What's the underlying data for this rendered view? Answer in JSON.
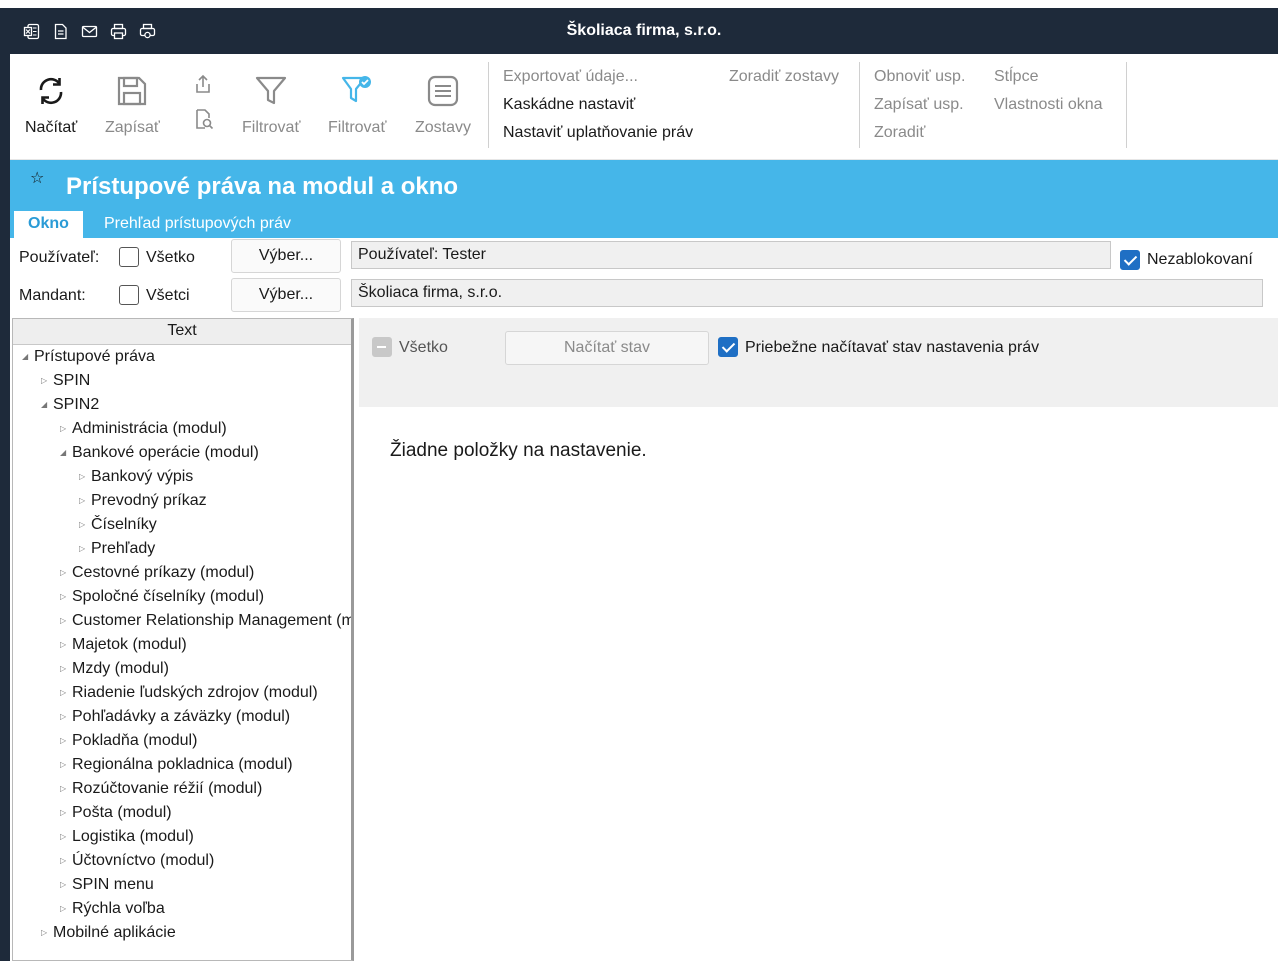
{
  "window": {
    "title": "Školiaca firma, s.r.o.",
    "title_icons": [
      "excel-icon",
      "document-icon",
      "mail-icon",
      "print-icon",
      "print-preview-icon"
    ]
  },
  "ribbon": {
    "buttons": [
      {
        "label": "Načítať",
        "icon": "refresh-icon",
        "enabled": true
      },
      {
        "label": "Zapísať",
        "icon": "save-icon",
        "enabled": false
      },
      {
        "label": "Filtrovať",
        "icon": "filter-icon",
        "enabled": false
      },
      {
        "label": "Filtrovať",
        "icon": "filter-active-icon",
        "enabled": false
      },
      {
        "label": "Zostavy",
        "icon": "reports-icon",
        "enabled": false
      }
    ],
    "small_icons": [
      "share-icon",
      "find-document-icon"
    ],
    "links_group1": [
      {
        "label": "Exportovať údaje...",
        "enabled": false
      },
      {
        "label": "Kaskádne nastaviť",
        "enabled": true
      },
      {
        "label": "Nastaviť uplatňovanie práv",
        "enabled": true
      },
      {
        "label": "Zoradiť zostavy",
        "enabled": false
      }
    ],
    "links_group2": [
      {
        "label": "Obnoviť usp.",
        "enabled": false
      },
      {
        "label": "Zapísať usp.",
        "enabled": false
      },
      {
        "label": "Zoradiť",
        "enabled": false
      },
      {
        "label": "Stĺpce",
        "enabled": false
      },
      {
        "label": "Vlastnosti okna",
        "enabled": false
      }
    ]
  },
  "header": {
    "title": "Prístupové práva na modul a okno",
    "tabs": [
      "Okno",
      "Prehľad prístupových práv"
    ]
  },
  "filters": {
    "user_label": "Používateľ:",
    "user_all_label": "Všetko",
    "user_all_checked": false,
    "user_select_button": "Výber...",
    "user_value": "Používateľ: Tester",
    "not_blocked_label": "Nezablokovaní",
    "not_blocked_checked": true,
    "mandant_label": "Mandant:",
    "mandant_all_label": "Všetci",
    "mandant_all_checked": false,
    "mandant_select_button": "Výber...",
    "mandant_value": "Školiaca firma, s.r.o."
  },
  "tree": {
    "column_header": "Text",
    "items": [
      {
        "label": "Prístupové práva",
        "level": 0,
        "expanded": true
      },
      {
        "label": "SPIN",
        "level": 1,
        "expanded": false
      },
      {
        "label": "SPIN2",
        "level": 1,
        "expanded": true
      },
      {
        "label": "Administrácia (modul)",
        "level": 2,
        "expanded": false
      },
      {
        "label": "Bankové operácie (modul)",
        "level": 2,
        "expanded": true
      },
      {
        "label": "Bankový výpis",
        "level": 3,
        "expanded": false
      },
      {
        "label": "Prevodný príkaz",
        "level": 3,
        "expanded": false
      },
      {
        "label": "Číselníky",
        "level": 3,
        "expanded": false
      },
      {
        "label": "Prehľady",
        "level": 3,
        "expanded": false
      },
      {
        "label": "Cestovné príkazy (modul)",
        "level": 2,
        "expanded": false
      },
      {
        "label": "Spoločné číselníky (modul)",
        "level": 2,
        "expanded": false
      },
      {
        "label": "Customer Relationship Management (modul)",
        "level": 2,
        "expanded": false
      },
      {
        "label": "Majetok (modul)",
        "level": 2,
        "expanded": false
      },
      {
        "label": "Mzdy (modul)",
        "level": 2,
        "expanded": false
      },
      {
        "label": "Riadenie ľudských zdrojov (modul)",
        "level": 2,
        "expanded": false
      },
      {
        "label": "Pohľadávky a záväzky (modul)",
        "level": 2,
        "expanded": false
      },
      {
        "label": "Pokladňa (modul)",
        "level": 2,
        "expanded": false
      },
      {
        "label": "Regionálna pokladnica (modul)",
        "level": 2,
        "expanded": false
      },
      {
        "label": "Rozúčtovanie réžií (modul)",
        "level": 2,
        "expanded": false
      },
      {
        "label": "Pošta (modul)",
        "level": 2,
        "expanded": false
      },
      {
        "label": "Logistika (modul)",
        "level": 2,
        "expanded": false
      },
      {
        "label": "Účtovníctvo (modul)",
        "level": 2,
        "expanded": false
      },
      {
        "label": "SPIN menu",
        "level": 2,
        "expanded": false
      },
      {
        "label": "Rýchla voľba",
        "level": 2,
        "expanded": false
      },
      {
        "label": "Mobilné aplikácie",
        "level": 1,
        "expanded": false
      }
    ]
  },
  "right_panel": {
    "all_label": "Všetko",
    "load_state_button": "Načítať stav",
    "continuous_label": "Priebežne načítavať stav nastavenia práv",
    "continuous_checked": true,
    "empty_message": "Žiadne položky na nastavenie."
  }
}
